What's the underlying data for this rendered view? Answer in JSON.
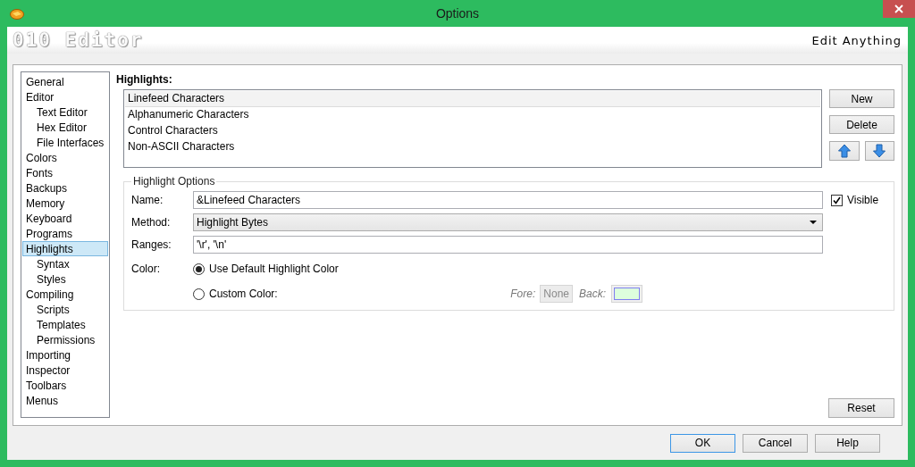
{
  "window": {
    "title": "Options"
  },
  "header": {
    "logo": "010 Editor",
    "tagline": "Edit Anything"
  },
  "sidebar": {
    "items": [
      {
        "label": "General",
        "selected": false
      },
      {
        "label": "Editor",
        "selected": false,
        "children": [
          {
            "label": "Text Editor",
            "selected": false
          },
          {
            "label": "Hex Editor",
            "selected": false
          },
          {
            "label": "File Interfaces",
            "selected": false
          }
        ]
      },
      {
        "label": "Colors",
        "selected": false
      },
      {
        "label": "Fonts",
        "selected": false
      },
      {
        "label": "Backups",
        "selected": false
      },
      {
        "label": "Memory",
        "selected": false
      },
      {
        "label": "Keyboard",
        "selected": false
      },
      {
        "label": "Programs",
        "selected": false
      },
      {
        "label": "Highlights",
        "selected": true,
        "children": [
          {
            "label": "Syntax",
            "selected": false
          },
          {
            "label": "Styles",
            "selected": false
          }
        ]
      },
      {
        "label": "Compiling",
        "selected": false,
        "children": [
          {
            "label": "Scripts",
            "selected": false
          },
          {
            "label": "Templates",
            "selected": false
          },
          {
            "label": "Permissions",
            "selected": false
          }
        ]
      },
      {
        "label": "Importing",
        "selected": false
      },
      {
        "label": "Inspector",
        "selected": false
      },
      {
        "label": "Toolbars",
        "selected": false
      },
      {
        "label": "Menus",
        "selected": false
      }
    ]
  },
  "highlights": {
    "heading": "Highlights:",
    "items": [
      {
        "label": "Linefeed Characters",
        "selected": true
      },
      {
        "label": "Alphanumeric Characters",
        "selected": false
      },
      {
        "label": "Control Characters",
        "selected": false
      },
      {
        "label": "Non-ASCII Characters",
        "selected": false
      }
    ],
    "buttons": [
      "New",
      "Delete"
    ]
  },
  "options": {
    "legend": "Highlight Options",
    "name": {
      "label": "Name:",
      "value": "&Linefeed Characters"
    },
    "visible": {
      "label": "Visible",
      "checked": true
    },
    "method": {
      "label": "Method:",
      "value": "Highlight Bytes"
    },
    "ranges": {
      "label": "Ranges:",
      "value": "'\\r', '\\n'"
    },
    "color": {
      "label": "Color:",
      "choices": [
        {
          "label": "Use Default Highlight Color",
          "selected": true
        },
        {
          "label": "Custom Color:",
          "selected": false
        }
      ],
      "fore": {
        "label": "Fore:",
        "value": "None"
      },
      "back": {
        "label": "Back:"
      },
      "disabled": true
    }
  },
  "reset": "Reset",
  "footer": {
    "buttons": [
      {
        "label": "OK",
        "focused": true
      },
      {
        "label": "Cancel",
        "focused": false
      },
      {
        "label": "Help",
        "focused": false
      }
    ]
  }
}
